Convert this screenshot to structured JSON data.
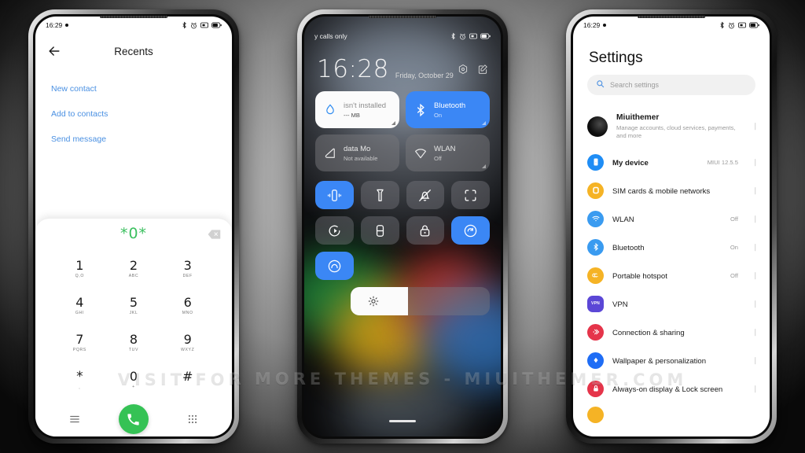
{
  "watermark": "VISIT FOR MORE THEMES - MIUITHEMER.COM",
  "phone_dialer": {
    "status": {
      "time": "16:29",
      "icons": [
        "bluetooth-icon",
        "alarm-icon",
        "sim-icon",
        "battery-icon"
      ]
    },
    "header": {
      "back": "back-arrow-icon",
      "title": "Recents"
    },
    "links": [
      {
        "label": "New contact"
      },
      {
        "label": "Add to contacts"
      },
      {
        "label": "Send message"
      }
    ],
    "dial": {
      "number": "*0*",
      "backspace": "backspace-icon",
      "keys": [
        {
          "num": "1",
          "sub": "Q,O"
        },
        {
          "num": "2",
          "sub": "ABC"
        },
        {
          "num": "3",
          "sub": "DEF"
        },
        {
          "num": "4",
          "sub": "GHI"
        },
        {
          "num": "5",
          "sub": "JKL"
        },
        {
          "num": "6",
          "sub": "MNO"
        },
        {
          "num": "7",
          "sub": "PQRS"
        },
        {
          "num": "8",
          "sub": "TUV"
        },
        {
          "num": "9",
          "sub": "WXYZ"
        },
        {
          "num": "*",
          "sub": ","
        },
        {
          "num": "0",
          "sub": "+"
        },
        {
          "num": "#",
          "sub": ""
        }
      ],
      "bottom": {
        "menu": "menu-icon",
        "call": "call-icon",
        "keypad": "keypad-icon"
      }
    }
  },
  "phone_controlcenter": {
    "status": {
      "carrier": "y calls only",
      "icons": [
        "bluetooth-icon",
        "alarm-icon",
        "sim-icon",
        "battery-icon"
      ]
    },
    "clock": {
      "time": "16:28",
      "date": "Friday, October 29"
    },
    "header_icons": [
      "settings-gear-icon",
      "edit-icon"
    ],
    "cards": [
      {
        "title": "isn't installed",
        "sub": "--- MB",
        "icon": "water-drop-icon",
        "style": "white"
      },
      {
        "title": "Bluetooth",
        "sub": "On",
        "icon": "bluetooth-icon",
        "style": "blue"
      },
      {
        "title": "data            Mo",
        "sub": "Not available",
        "icon": "mobile-data-icon",
        "style": "grey"
      },
      {
        "title": "WLAN",
        "sub": "Off",
        "icon": "wlan-icon",
        "style": "grey"
      }
    ],
    "toggles": [
      {
        "icon": "vibrate-icon",
        "on": true
      },
      {
        "icon": "flashlight-icon",
        "on": false
      },
      {
        "icon": "mute-icon",
        "on": false
      },
      {
        "icon": "screenshot-icon",
        "on": false
      },
      {
        "icon": "auto-rotate-icon",
        "on": false
      },
      {
        "icon": "battery-saver-icon",
        "on": false
      },
      {
        "icon": "lock-icon",
        "on": false
      },
      {
        "icon": "cast-icon",
        "on": true
      },
      {
        "icon": "reading-mode-icon",
        "on": true
      }
    ],
    "brightness": {
      "icon": "brightness-icon",
      "level": 41
    }
  },
  "phone_settings": {
    "status": {
      "time": "16:29",
      "icons": [
        "bluetooth-icon",
        "alarm-icon",
        "sim-icon",
        "battery-icon"
      ]
    },
    "title": "Settings",
    "search": {
      "icon": "search-icon",
      "placeholder": "Search settings"
    },
    "rows": [
      {
        "label": "Miuithemer",
        "desc": "Manage accounts, cloud services, payments, and more",
        "value": "",
        "icon": "avatar",
        "color": "#111111"
      },
      {
        "label": "My device",
        "desc": "",
        "value": "MIUI 12.5.5",
        "icon": "device-icon",
        "color": "#1f8df5"
      },
      {
        "label": "SIM cards & mobile networks",
        "desc": "",
        "value": "",
        "icon": "sim-card-icon",
        "color": "#f5b325"
      },
      {
        "label": "WLAN",
        "desc": "",
        "value": "Off",
        "icon": "wifi-icon",
        "color": "#3a9bf0"
      },
      {
        "label": "Bluetooth",
        "desc": "",
        "value": "On",
        "icon": "bluetooth-icon",
        "color": "#3a9bf0"
      },
      {
        "label": "Portable hotspot",
        "desc": "",
        "value": "Off",
        "icon": "hotspot-icon",
        "color": "#f5b325"
      },
      {
        "label": "VPN",
        "desc": "",
        "value": "",
        "icon": "vpn-icon",
        "color": "#5b47d6"
      },
      {
        "label": "Connection & sharing",
        "desc": "",
        "value": "",
        "icon": "share-icon",
        "color": "#e5344a"
      },
      {
        "label": "Wallpaper & personalization",
        "desc": "",
        "value": "",
        "icon": "wallpaper-icon",
        "color": "#1f6df5"
      },
      {
        "label": "Always-on display & Lock screen",
        "desc": "",
        "value": "",
        "icon": "lock-icon",
        "color": "#e5344a"
      }
    ]
  }
}
